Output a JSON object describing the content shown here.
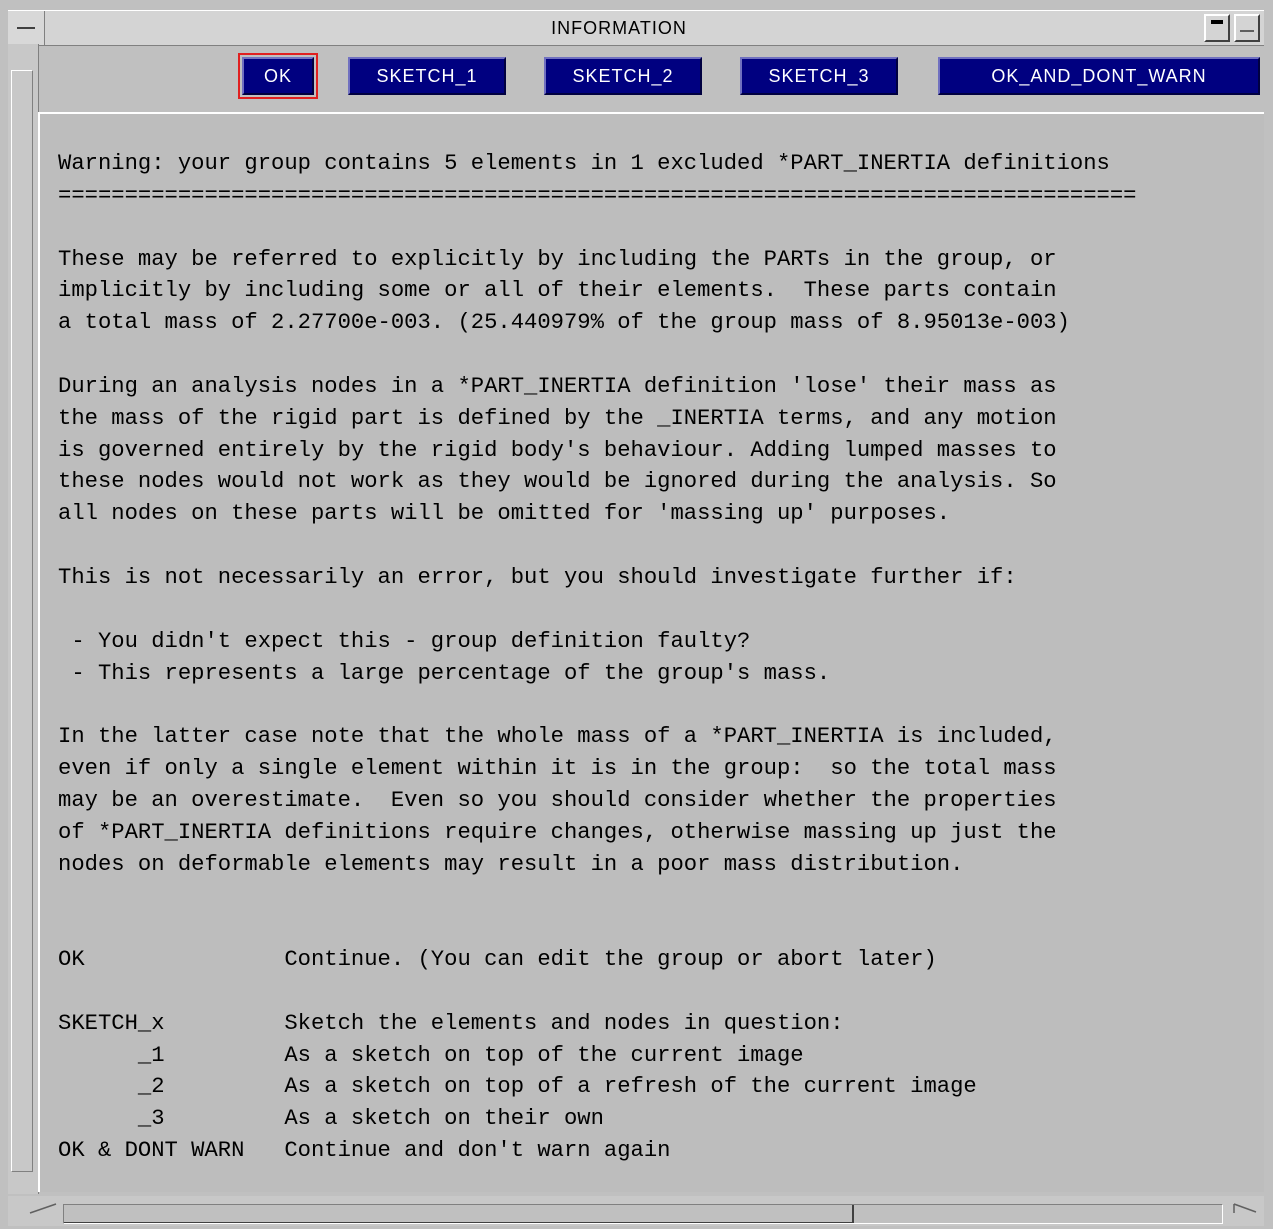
{
  "window": {
    "title": "INFORMATION"
  },
  "buttons": {
    "ok": "OK",
    "sketch_1": "SKETCH_1",
    "sketch_2": "SKETCH_2",
    "sketch_3": "SKETCH_3",
    "ok_and_dont_warn": "OK_AND_DONT_WARN"
  },
  "message": {
    "text": "Warning: your group contains 5 elements in 1 excluded *PART_INERTIA definitions\n=================================================================================\n\nThese may be referred to explicitly by including the PARTs in the group, or\nimplicitly by including some or all of their elements.  These parts contain\na total mass of 2.27700e-003. (25.440979% of the group mass of 8.95013e-003)\n\nDuring an analysis nodes in a *PART_INERTIA definition 'lose' their mass as\nthe mass of the rigid part is defined by the _INERTIA terms, and any motion\nis governed entirely by the rigid body's behaviour. Adding lumped masses to\nthese nodes would not work as they would be ignored during the analysis. So\nall nodes on these parts will be omitted for 'massing up' purposes.\n\nThis is not necessarily an error, but you should investigate further if:\n\n - You didn't expect this - group definition faulty?\n - This represents a large percentage of the group's mass.\n\nIn the latter case note that the whole mass of a *PART_INERTIA is included,\neven if only a single element within it is in the group:  so the total mass\nmay be an overestimate.  Even so you should consider whether the properties\nof *PART_INERTIA definitions require changes, otherwise massing up just the\nnodes on deformable elements may result in a poor mass distribution.\n\n\nOK               Continue. (You can edit the group or abort later)\n\nSKETCH_x         Sketch the elements and nodes in question:\n      _1         As a sketch on top of the current image\n      _2         As a sketch on top of a refresh of the current image\n      _3         As a sketch on their own\nOK & DONT WARN   Continue and don't warn again"
  },
  "colors": {
    "button_bg": "#000080",
    "button_text": "#ffffff",
    "focus_outline": "#e02020",
    "panel_bg": "#bdbdbd"
  },
  "icons": {
    "window_menu": "window-menu-icon",
    "minimize": "minimize-icon",
    "maximize": "maximize-icon"
  }
}
